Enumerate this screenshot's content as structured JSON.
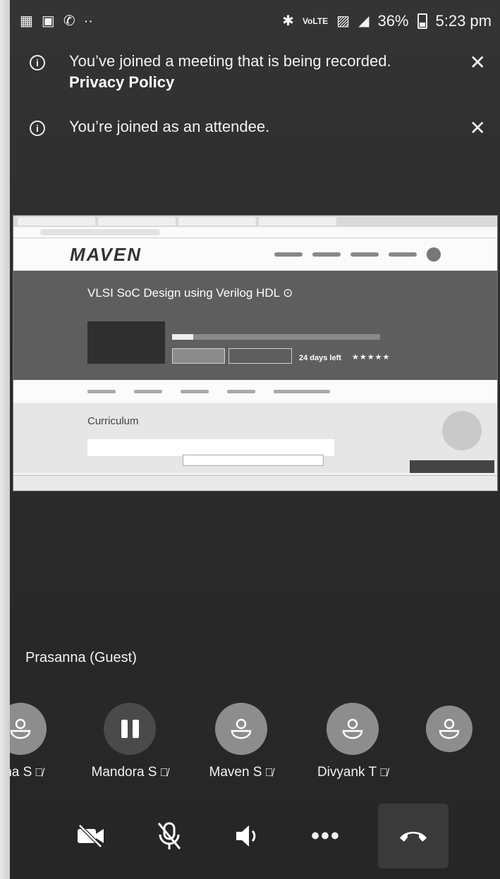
{
  "status_bar": {
    "left_icons": [
      "teams-icon",
      "gallery-icon",
      "phone-icon",
      "more-dots-icon"
    ],
    "right_icons": [
      "bluetooth-icon",
      "volte-icon",
      "sim-icon",
      "lte-signal-icon"
    ],
    "battery": "36%",
    "time": "5:23 pm"
  },
  "banners": [
    {
      "text": "You’ve joined a meeting that is being recorded.",
      "link": "Privacy Policy"
    },
    {
      "text": "You’re joined as an attendee."
    }
  ],
  "shared_screen": {
    "logo": "MAVEN",
    "course_title": "VLSI SoC Design using Verilog HDL ⊙",
    "days_left": "24 days left",
    "stars": "★★★★★",
    "curriculum_title": "Curriculum"
  },
  "presenter_name": "Prasanna (Guest)",
  "participants": [
    {
      "name": "itha S",
      "avatar": "person-icon"
    },
    {
      "name": "Mandora S",
      "avatar": "pause-icon"
    },
    {
      "name": "Maven S",
      "avatar": "person-icon"
    },
    {
      "name": "Divyank T",
      "avatar": "person-icon"
    },
    {
      "name": "",
      "avatar": "person-icon"
    }
  ],
  "controls": [
    "video-off-icon",
    "mic-off-icon",
    "speaker-icon",
    "more-options-icon",
    "hang-up-icon"
  ]
}
